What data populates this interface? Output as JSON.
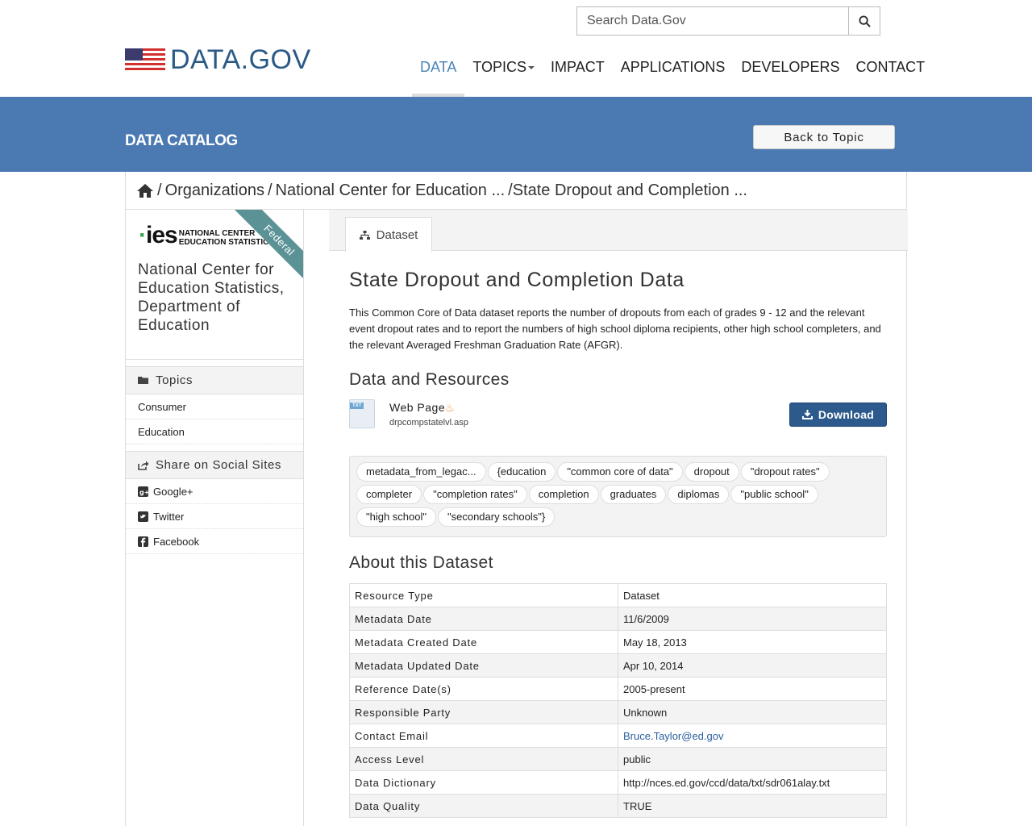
{
  "header": {
    "logo_text": "DATA.GOV",
    "search_placeholder": "Search Data.Gov",
    "nav": [
      {
        "label": "DATA",
        "active": true
      },
      {
        "label": "TOPICS",
        "dropdown": true
      },
      {
        "label": "IMPACT"
      },
      {
        "label": "APPLICATIONS"
      },
      {
        "label": "DEVELOPERS"
      },
      {
        "label": "CONTACT"
      }
    ]
  },
  "banner": {
    "title": "DATA CATALOG",
    "back_button": "Back to Topic",
    "color": "#4b79b1"
  },
  "breadcrumb": {
    "home_icon": "home-icon",
    "items": [
      "Organizations",
      "National Center for Education ...",
      "State Dropout and Completion ..."
    ]
  },
  "sidebar": {
    "org_logo_main": "ies",
    "org_logo_sub1": "NATIONAL CENTER",
    "org_logo_sub2": "EDUCATION STATISTICS",
    "ribbon": "Federal",
    "org_name": "National Center for Education Statistics, Department of Education",
    "topics_heading": "Topics",
    "topics": [
      "Consumer",
      "Education"
    ],
    "share_heading": "Share on Social Sites",
    "share": [
      {
        "label": "Google+",
        "icon": "google-plus-icon"
      },
      {
        "label": "Twitter",
        "icon": "twitter-icon"
      },
      {
        "label": "Facebook",
        "icon": "facebook-icon"
      }
    ]
  },
  "content": {
    "tab_label": "Dataset",
    "title": "State Dropout and Completion Data",
    "description": "This Common Core of Data dataset reports the number of dropouts from each of grades 9 - 12 and the relevant event dropout rates and to report the numbers of high school diploma recipients, other high school completers, and the relevant Averaged Freshman Graduation Rate (AFGR).",
    "resources_heading": "Data and Resources",
    "resource": {
      "icon_tag": "TXT",
      "name": "Web Page",
      "file": "drpcompstatelvl.asp",
      "download_label": "Download"
    },
    "tags": [
      "metadata_from_legac...",
      "{education",
      "\"common core of data\"",
      "dropout",
      "\"dropout rates\"",
      "completer",
      "\"completion rates\"",
      "completion",
      "graduates",
      "diplomas",
      "\"public school\"",
      "\"high school\"",
      "\"secondary schools\"}"
    ],
    "about_heading": "About this Dataset",
    "about": [
      {
        "key": "Resource Type",
        "value": "Dataset"
      },
      {
        "key": "Metadata Date",
        "value": "11/6/2009"
      },
      {
        "key": "Metadata Created Date",
        "value": "May 18, 2013"
      },
      {
        "key": "Metadata Updated Date",
        "value": "Apr 10, 2014"
      },
      {
        "key": "Reference Date(s)",
        "value": "2005-present"
      },
      {
        "key": "Responsible Party",
        "value": "Unknown"
      },
      {
        "key": "Contact Email",
        "value": "Bruce.Taylor@ed.gov",
        "link": true
      },
      {
        "key": "Access Level",
        "value": "public"
      },
      {
        "key": "Data Dictionary",
        "value": "http://nces.ed.gov/ccd/data/txt/sdr061alay.txt"
      },
      {
        "key": "Data Quality",
        "value": "TRUE"
      }
    ]
  }
}
